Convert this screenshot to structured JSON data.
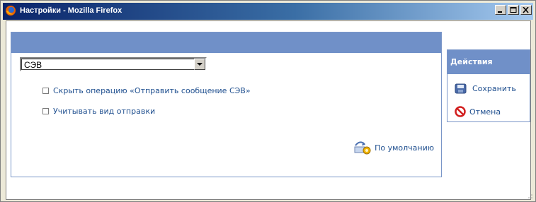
{
  "window": {
    "title": "Настройки - Mozilla Firefox"
  },
  "settings": {
    "select_value": "СЭВ",
    "options": [
      {
        "label": "Скрыть операцию «Отправить сообщение СЭВ»",
        "checked": false
      },
      {
        "label": "Учитывать вид отправки",
        "checked": false
      }
    ],
    "default_label": "По умолчанию"
  },
  "actions": {
    "title": "Действия",
    "save_label": "Сохранить",
    "cancel_label": "Отмена"
  },
  "colors": {
    "panel_header": "#7090c8",
    "link": "#1f4f8f",
    "titlebar": "#0a246a"
  }
}
